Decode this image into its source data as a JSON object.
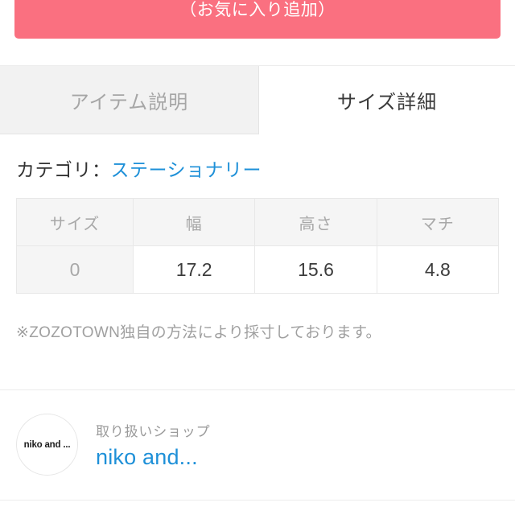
{
  "favorite_button": {
    "label": "（お気に入り追加）",
    "color": "#fa7080",
    "text_color": "#ffffff"
  },
  "tabs": [
    {
      "label": "アイテム説明",
      "active": false
    },
    {
      "label": "サイズ詳細",
      "active": true
    }
  ],
  "category": {
    "label": "カテゴリ：",
    "value": "ステーショナリー",
    "link_color": "#1e90d8"
  },
  "size_table": {
    "headers": [
      "サイズ",
      "幅",
      "高さ",
      "マチ"
    ],
    "rows": [
      [
        "0",
        "17.2",
        "15.6",
        "4.8"
      ]
    ]
  },
  "note": "※ZOZOTOWN独自の方法により採寸しております。",
  "shop": {
    "logo_text": "niko and ...",
    "label": "取り扱いショップ",
    "name": "niko and...",
    "link_color": "#1e90d8"
  }
}
